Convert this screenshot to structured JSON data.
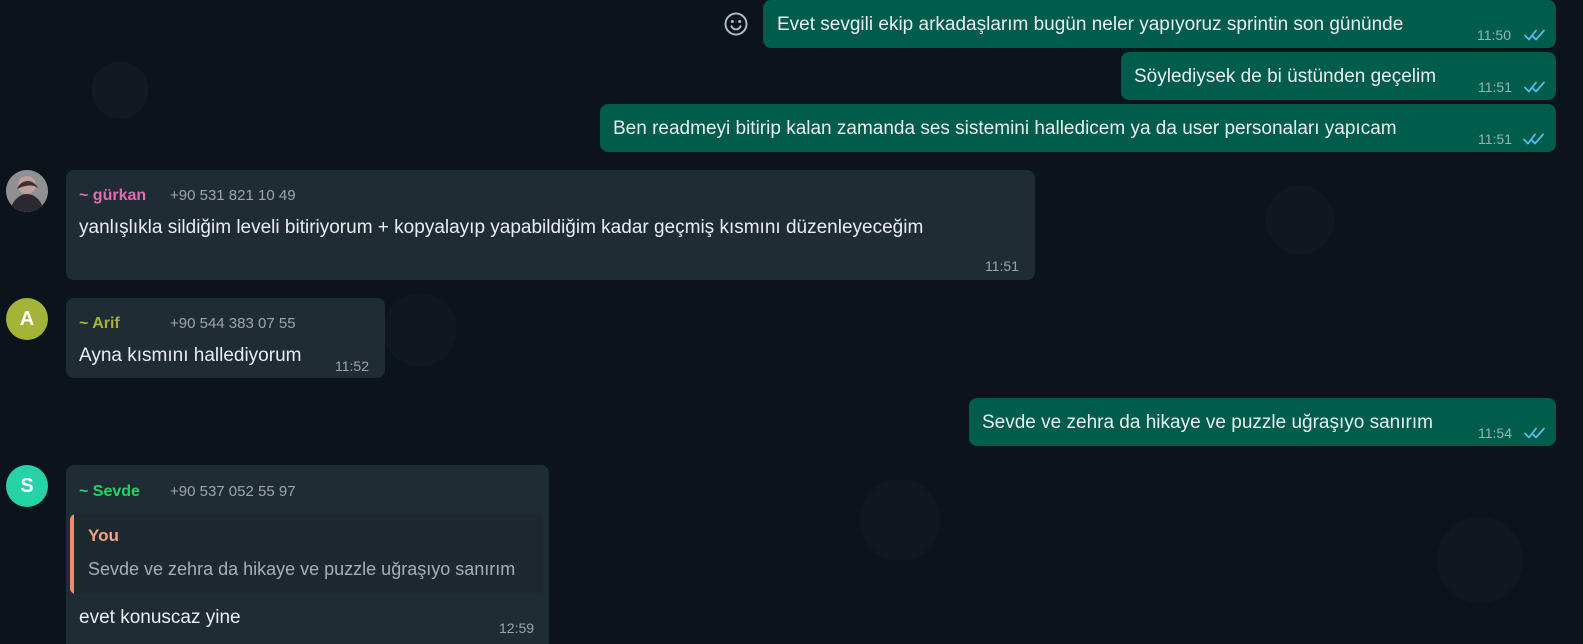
{
  "messages": [
    {
      "id": "m1",
      "direction": "outgoing",
      "text": "Evet sevgili ekip arkadaşlarım bugün neler yapıyoruz sprintin son gününde",
      "time": "11:50",
      "status": "read"
    },
    {
      "id": "m2",
      "direction": "outgoing",
      "text": "Söylediysek de bi üstünden geçelim",
      "time": "11:51",
      "status": "read"
    },
    {
      "id": "m3",
      "direction": "outgoing",
      "text": "Ben readmeyi bitirip kalan zamanda ses sistemini halledicem ya da user personaları yapıcam",
      "time": "11:51",
      "status": "read"
    },
    {
      "id": "m4",
      "direction": "incoming",
      "sender": "~ gürkan",
      "phone": "+90 531 821 10 49",
      "text": "yanlışlıkla sildiğim leveli bitiriyorum + kopyalayıp yapabildiğim kadar geçmiş kısmını düzenleyeceğim",
      "time": "11:51",
      "avatar": "photo"
    },
    {
      "id": "m5",
      "direction": "incoming",
      "sender": "~ Arif",
      "phone": "+90 544 383 07 55",
      "text": "Ayna kısmını hallediyorum",
      "time": "11:52",
      "avatar": "A"
    },
    {
      "id": "m6",
      "direction": "outgoing",
      "text": "Sevde ve zehra da hikaye ve puzzle uğraşıyo sanırım",
      "time": "11:54",
      "status": "read"
    },
    {
      "id": "m7",
      "direction": "incoming",
      "sender": "~ Sevde",
      "phone": "+90 537 052 55 97",
      "quote": {
        "author": "You",
        "text": "Sevde ve zehra da hikaye ve puzzle uğraşıyo sanırım"
      },
      "text": "evet konuscaz yine",
      "time": "12:59",
      "avatar": "S"
    }
  ],
  "icons": {
    "emoji": "emoji-icon",
    "read_receipt": "double-check-icon"
  },
  "colors": {
    "chat_background": "#0b141a",
    "outgoing_bubble": "#005c4b",
    "incoming_bubble": "#202c33",
    "read_receipt": "#53bdeb",
    "gurkan_name": "#e26ab6",
    "arif_name": "#a5b337",
    "arif_avatar": "#a5b337",
    "sevde_name": "#25d366",
    "sevde_avatar": "#25d3a6",
    "quote_author": "#f4a280",
    "quote_bar": "#f08c6a"
  }
}
